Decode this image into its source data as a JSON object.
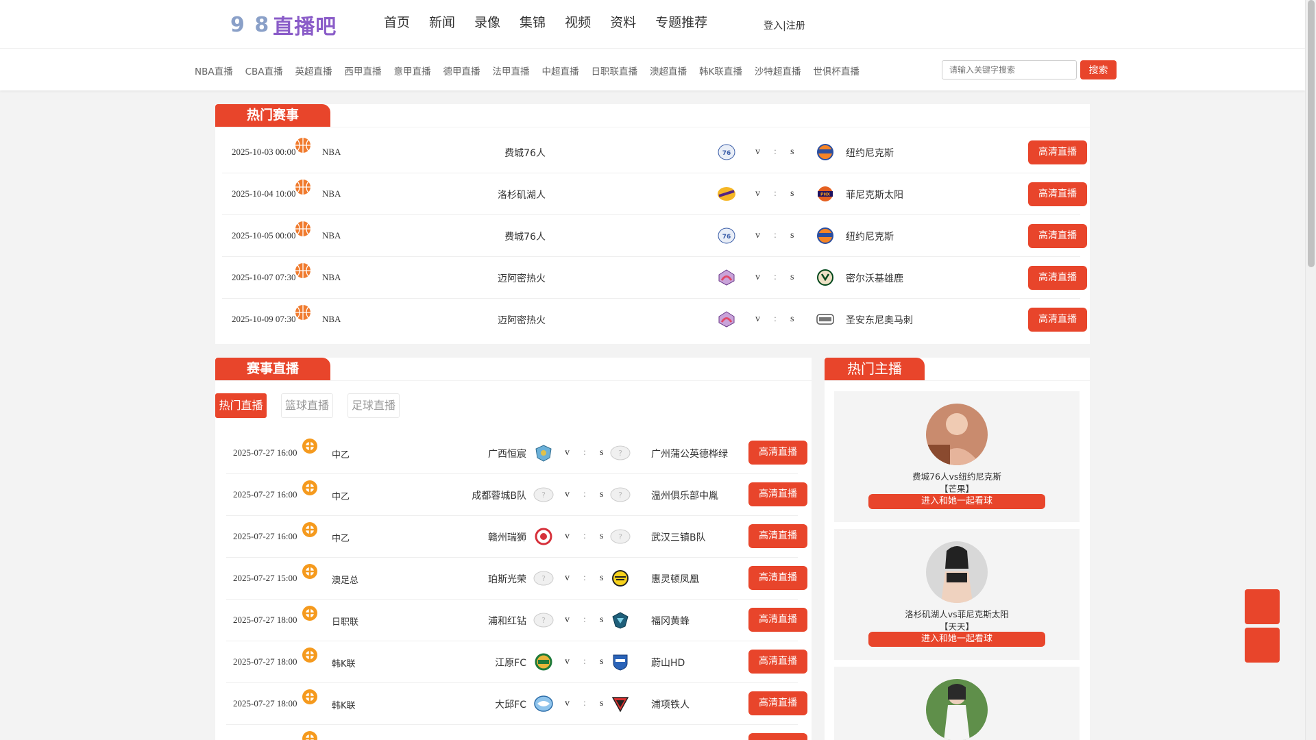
{
  "header": {
    "logo_digits": "9 8",
    "logo_text": "直播吧",
    "nav": [
      "首页",
      "新闻",
      "录像",
      "集锦",
      "视频",
      "资料",
      "专题推荐"
    ],
    "login": "登入",
    "login_sep": "|",
    "register": "注册"
  },
  "subnav": [
    "NBA直播",
    "CBA直播",
    "英超直播",
    "西甲直播",
    "意甲直播",
    "德甲直播",
    "法甲直播",
    "中超直播",
    "日职联直播",
    "澳超直播",
    "韩K联直播",
    "沙特超直播",
    "世俱杯直播"
  ],
  "search": {
    "placeholder": "请输入关键字搜索",
    "button": "搜索"
  },
  "hot_matches": {
    "title": "热门赛事",
    "rows": [
      {
        "time": "2025-10-03 00:00",
        "league": "NBA",
        "home": "费城76人",
        "away": "纽约尼克斯",
        "v": "v",
        "colon": ":",
        "s": "s",
        "button": "高清直播"
      },
      {
        "time": "2025-10-04 10:00",
        "league": "NBA",
        "home": "洛杉矶湖人",
        "away": "菲尼克斯太阳",
        "v": "v",
        "colon": ":",
        "s": "s",
        "button": "高清直播"
      },
      {
        "time": "2025-10-05 00:00",
        "league": "NBA",
        "home": "费城76人",
        "away": "纽约尼克斯",
        "v": "v",
        "colon": ":",
        "s": "s",
        "button": "高清直播"
      },
      {
        "time": "2025-10-07 07:30",
        "league": "NBA",
        "home": "迈阿密热火",
        "away": "密尔沃基雄鹿",
        "v": "v",
        "colon": ":",
        "s": "s",
        "button": "高清直播"
      },
      {
        "time": "2025-10-09 07:30",
        "league": "NBA",
        "home": "迈阿密热火",
        "away": "圣安东尼奥马刺",
        "v": "v",
        "colon": ":",
        "s": "s",
        "button": "高清直播"
      }
    ]
  },
  "live": {
    "title": "赛事直播",
    "tabs": [
      "热门直播",
      "篮球直播",
      "足球直播"
    ],
    "rows": [
      {
        "time": "2025-07-27 16:00",
        "league": "中乙",
        "home": "广西恒宸",
        "away": "广州蒲公英德桦绿",
        "v": "v",
        "colon": ":",
        "s": "s",
        "button": "高清直播"
      },
      {
        "time": "2025-07-27 16:00",
        "league": "中乙",
        "home": "成都蓉城B队",
        "away": "温州俱乐部中胤",
        "v": "v",
        "colon": ":",
        "s": "s",
        "button": "高清直播"
      },
      {
        "time": "2025-07-27 16:00",
        "league": "中乙",
        "home": "赣州瑞狮",
        "away": "武汉三镇B队",
        "v": "v",
        "colon": ":",
        "s": "s",
        "button": "高清直播"
      },
      {
        "time": "2025-07-27 15:00",
        "league": "澳足总",
        "home": "珀斯光荣",
        "away": "惠灵顿凤凰",
        "v": "v",
        "colon": ":",
        "s": "s",
        "button": "高清直播"
      },
      {
        "time": "2025-07-27 18:00",
        "league": "日职联",
        "home": "浦和红钻",
        "away": "福冈黄蜂",
        "v": "v",
        "colon": ":",
        "s": "s",
        "button": "高清直播"
      },
      {
        "time": "2025-07-27 18:00",
        "league": "韩K联",
        "home": "江原FC",
        "away": "蔚山HD",
        "v": "v",
        "colon": ":",
        "s": "s",
        "button": "高清直播"
      },
      {
        "time": "2025-07-27 18:00",
        "league": "韩K联",
        "home": "大邱FC",
        "away": "浦项铁人",
        "v": "v",
        "colon": ":",
        "s": "s",
        "button": "高清直播"
      }
    ]
  },
  "anchors": {
    "title": "热门主播",
    "items": [
      {
        "match": "费城76人vs纽约尼克斯",
        "name": "【芒果】",
        "button": "进入和她一起看球"
      },
      {
        "match": "洛杉矶湖人vs菲尼克斯太阳",
        "name": "【天天】",
        "button": "进入和她一起看球"
      },
      {
        "match": "",
        "name": "",
        "button": ""
      }
    ]
  },
  "colors": {
    "accent": "#e8452b",
    "basketball": "#f07b2e",
    "football": "#f59a1e"
  }
}
